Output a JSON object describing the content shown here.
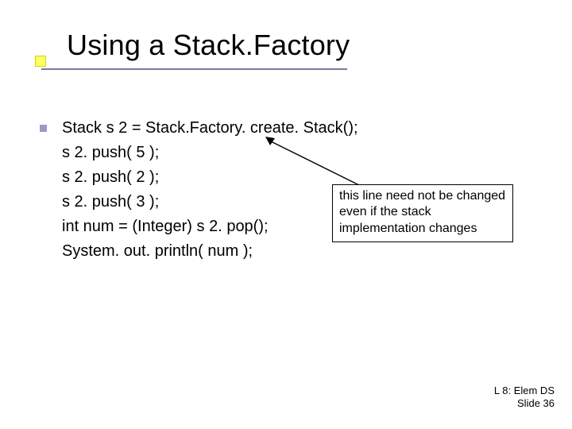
{
  "title": "Using a Stack.Factory",
  "code": [
    "Stack s 2 = Stack.Factory. create. Stack();",
    "s 2. push( 5 );",
    "s 2. push( 2 );",
    "s 2. push( 3 );",
    "int num = (Integer) s 2. pop();",
    "System. out. println( num );"
  ],
  "callout": "this line need not be changed even if the stack implementation changes",
  "footer": {
    "line1": "L 8: Elem DS",
    "line2": "Slide 36"
  }
}
